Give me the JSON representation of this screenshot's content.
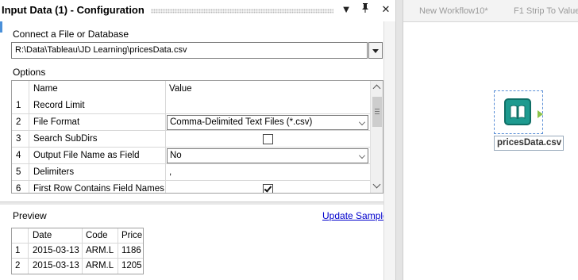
{
  "config": {
    "title": "Input Data (1) - Configuration",
    "controls": {
      "dropdown": "▼",
      "pin": "ᵽ",
      "close": "✕"
    },
    "connect_label": "Connect a File or Database",
    "file_path": "R:\\Data\\Tableau\\JD Learning\\pricesData.csv",
    "options_label": "Options",
    "options_headers": {
      "num": "",
      "name": "Name",
      "value": "Value"
    },
    "options_rows": [
      {
        "num": "1",
        "name": "Record Limit",
        "value": ""
      },
      {
        "num": "2",
        "name": "File Format",
        "value": "Comma-Delimited Text Files (*.csv)"
      },
      {
        "num": "3",
        "name": "Search SubDirs",
        "value": "",
        "checked": false
      },
      {
        "num": "4",
        "name": "Output File Name as Field",
        "value": "No"
      },
      {
        "num": "5",
        "name": "Delimiters",
        "value": ","
      },
      {
        "num": "6",
        "name": "First Row Contains Field Names",
        "value": "",
        "checked": true
      }
    ],
    "preview_label": "Preview",
    "update_sample": "Update Sample",
    "preview_headers": [
      "",
      "Date",
      "Code",
      "Price"
    ],
    "preview_rows": [
      [
        "1",
        "2015-03-13",
        "ARM.L",
        "1186"
      ],
      [
        "2",
        "2015-03-13",
        "ARM.L",
        "1205"
      ]
    ]
  },
  "canvas": {
    "tabs": [
      "New Workflow10*",
      "F1 Strip To Value"
    ],
    "tool": {
      "icon": "book-icon",
      "label": "pricesData.csv",
      "color": "#1d9a8f"
    }
  }
}
